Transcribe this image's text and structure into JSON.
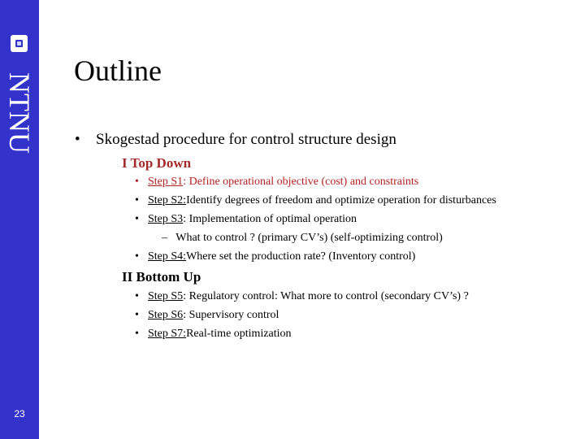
{
  "sidebar": {
    "logo_text": "NTNU",
    "page_number": "23",
    "color": "#3333cc"
  },
  "slide": {
    "title": "Outline",
    "main_bullet": "Skogestad procedure for control structure design",
    "bullet_glyph": "•",
    "dash_glyph": "–",
    "sections": [
      {
        "heading": "I  Top Down",
        "color": "#a52a2a",
        "steps": [
          {
            "label": "Step S1",
            "text": ": Define operational objective (cost) and constraints"
          },
          {
            "label": "Step S2:",
            "text": " Identify degrees of freedom and optimize operation for disturbances"
          },
          {
            "label": "Step S3",
            "text": ": Implementation of optimal operation"
          },
          {
            "label": "Step S4:",
            "text": " Where set the production rate? (Inventory control)"
          }
        ],
        "sub_item": "What to control ? (primary CV’s) (self-optimizing control)"
      },
      {
        "heading": "II Bottom Up",
        "steps": [
          {
            "label": "Step S5",
            "text": ": Regulatory control:  What more to control (secondary CV’s) ?"
          },
          {
            "label": "Step S6",
            "text": ": Supervisory control"
          },
          {
            "label": "Step S7:",
            "text": " Real-time optimization"
          }
        ]
      }
    ]
  }
}
